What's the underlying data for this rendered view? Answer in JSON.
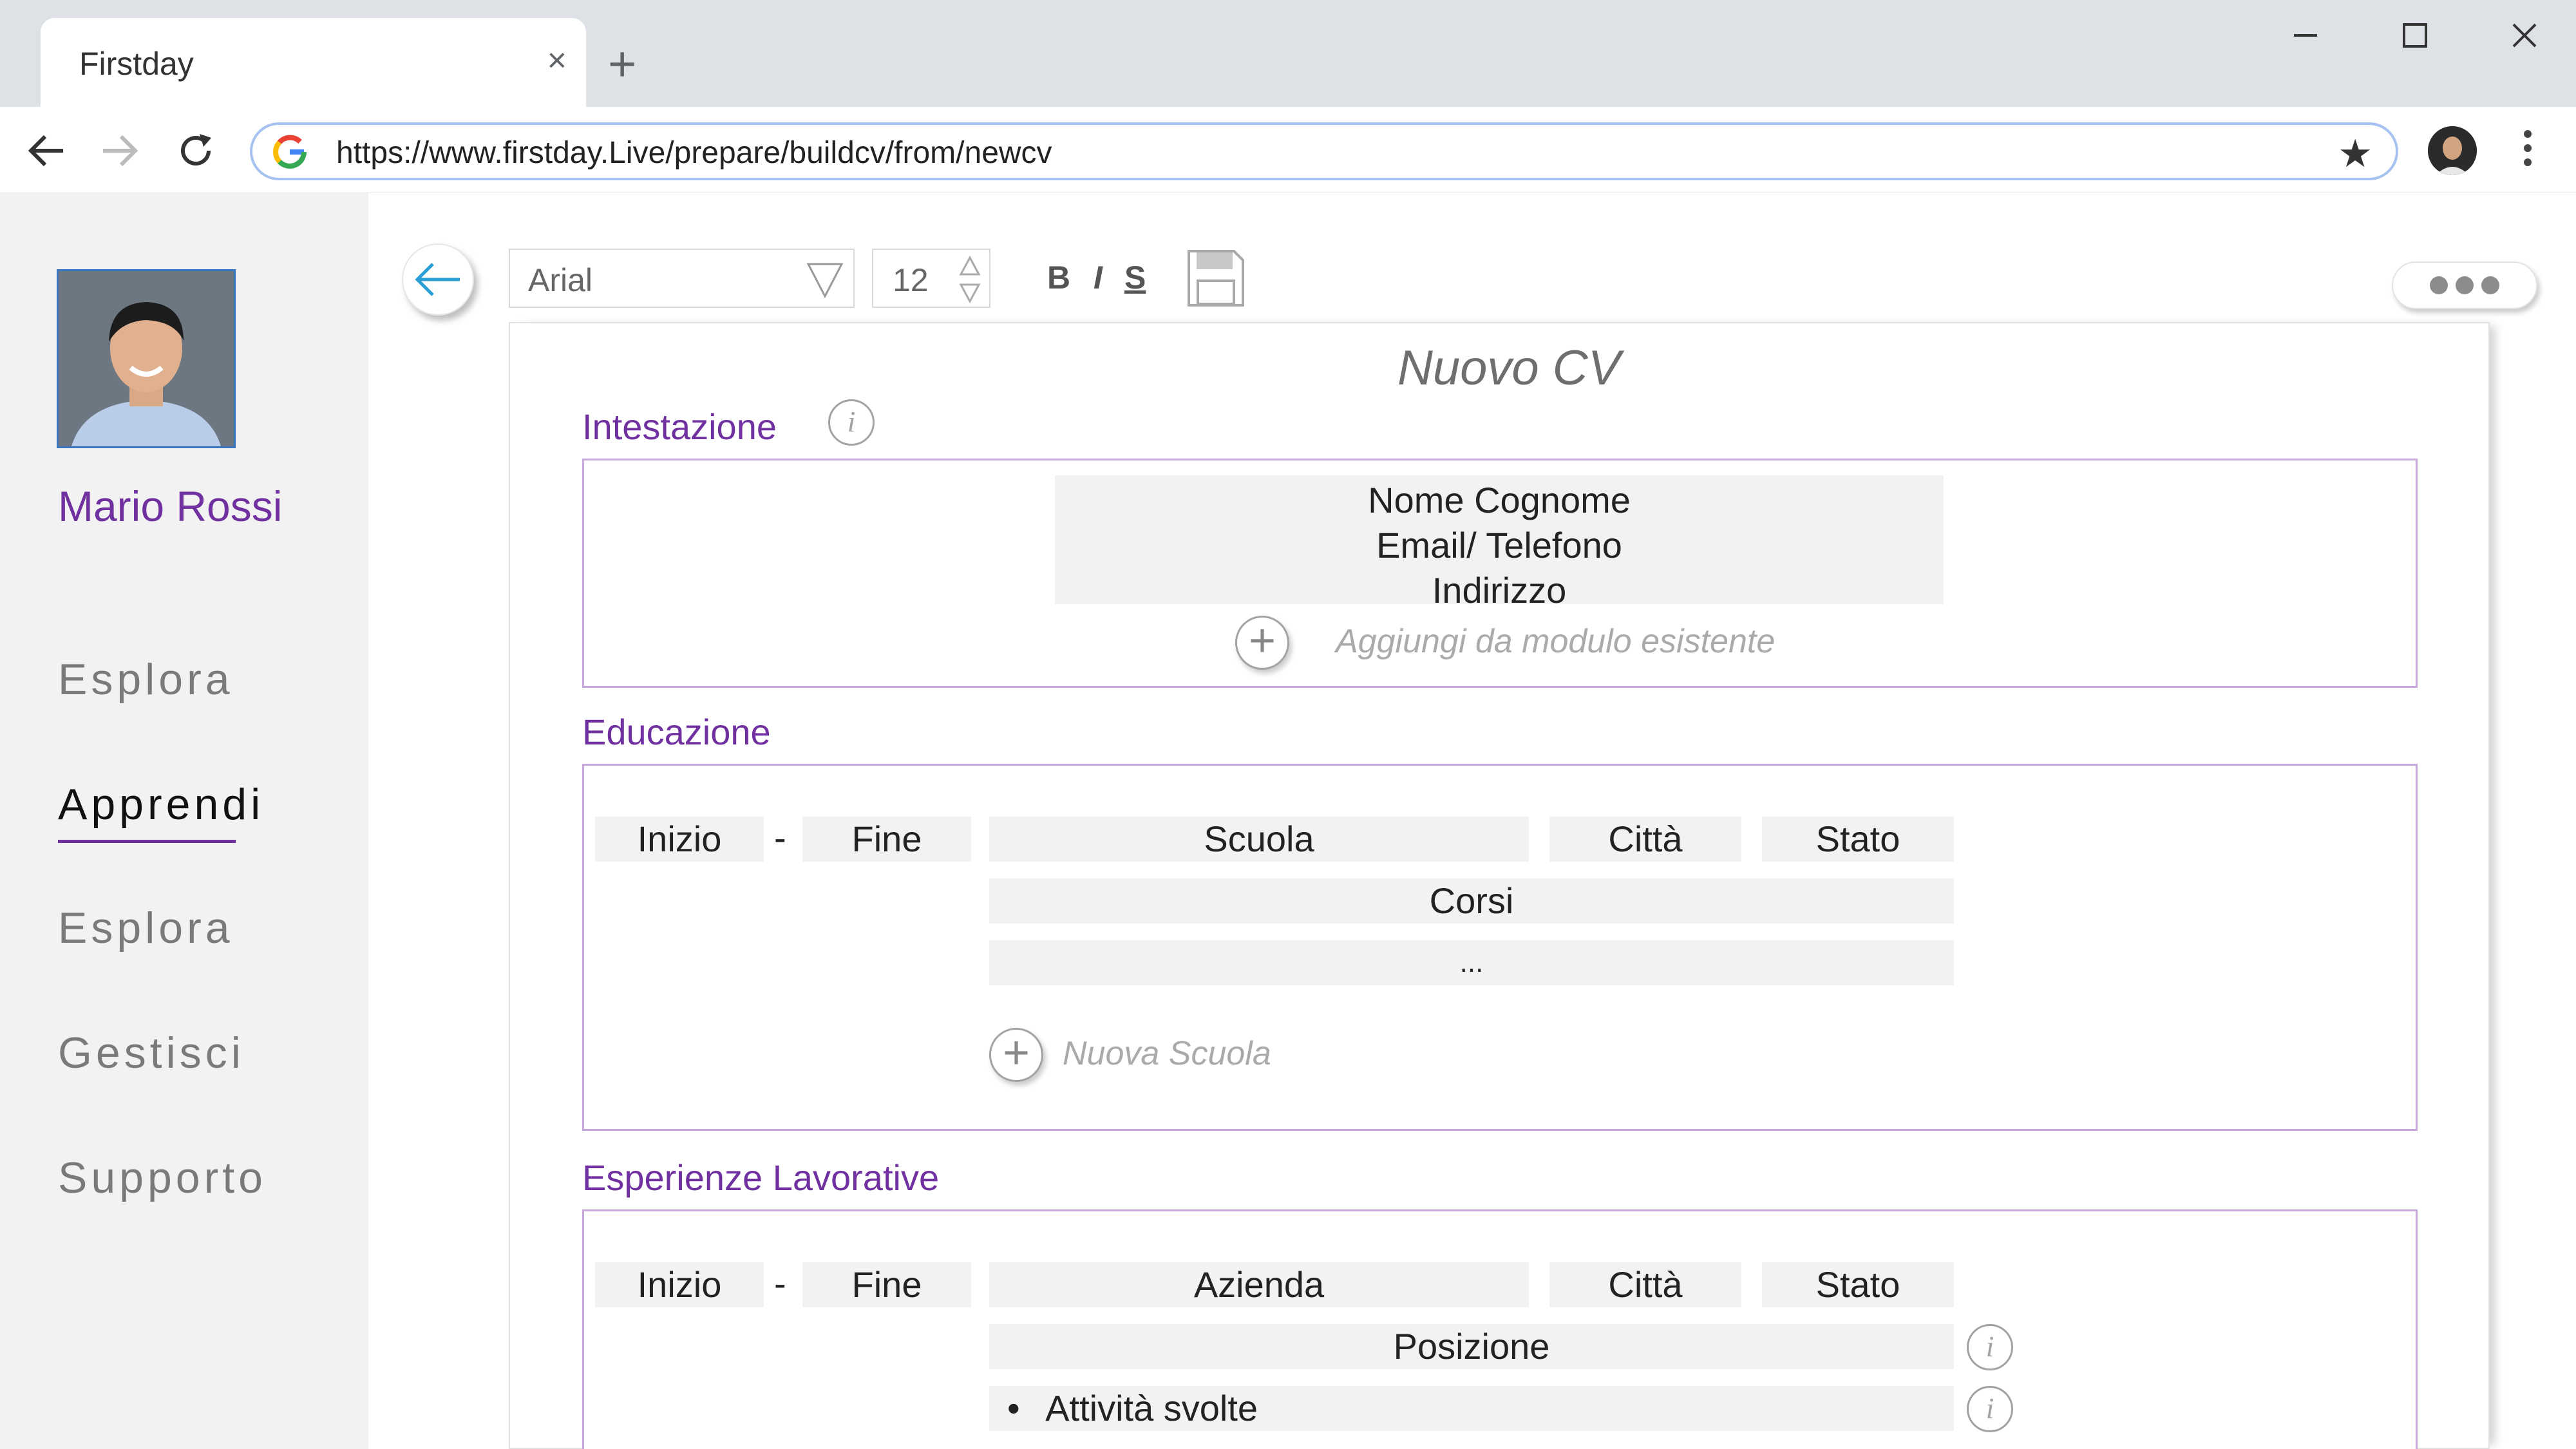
{
  "browser": {
    "tab_title": "Firstday",
    "tab_close": "×",
    "new_tab": "+",
    "url": "https://www.firstday.Live/prepare/buildcv/from/newcv"
  },
  "sidebar": {
    "user_name": "Mario Rossi",
    "items": [
      {
        "label": "Esplora",
        "active": false
      },
      {
        "label": "Apprendi",
        "active": true
      },
      {
        "label": "Esplora",
        "active": false
      },
      {
        "label": "Gestisci",
        "active": false
      },
      {
        "label": "Supporto",
        "active": false
      }
    ]
  },
  "toolbar": {
    "font": "Arial",
    "size": "12",
    "bold": "B",
    "italic": "I",
    "strike": "S"
  },
  "document": {
    "title": "Nuovo CV",
    "intestazione": {
      "title": "Intestazione",
      "info": "i",
      "lines": [
        "Nome Cognome",
        "Email/  Telefono",
        "Indirizzo"
      ],
      "add_hint": "Aggiungi da modulo esistente"
    },
    "educazione": {
      "title": "Educazione",
      "start": "Inizio",
      "dash": "-",
      "end": "Fine",
      "school": "Scuola",
      "city": "Città",
      "state": "Stato",
      "courses": "Corsi",
      "more": "...",
      "add_hint": "Nuova Scuola"
    },
    "esperienze": {
      "title": "Esperienze Lavorative",
      "start": "Inizio",
      "dash": "-",
      "end": "Fine",
      "company": "Azienda",
      "city": "Città",
      "state": "Stato",
      "position": "Posizione",
      "activities": "Attività svolte",
      "bullet": "•",
      "info": "i"
    }
  },
  "colors": {
    "accent": "#7030a0",
    "sidebar_bg": "#f2f2f2",
    "field_bg": "#f2f2f2",
    "section_border": "#c7a8dc",
    "back_arrow": "#2a9fd6"
  }
}
